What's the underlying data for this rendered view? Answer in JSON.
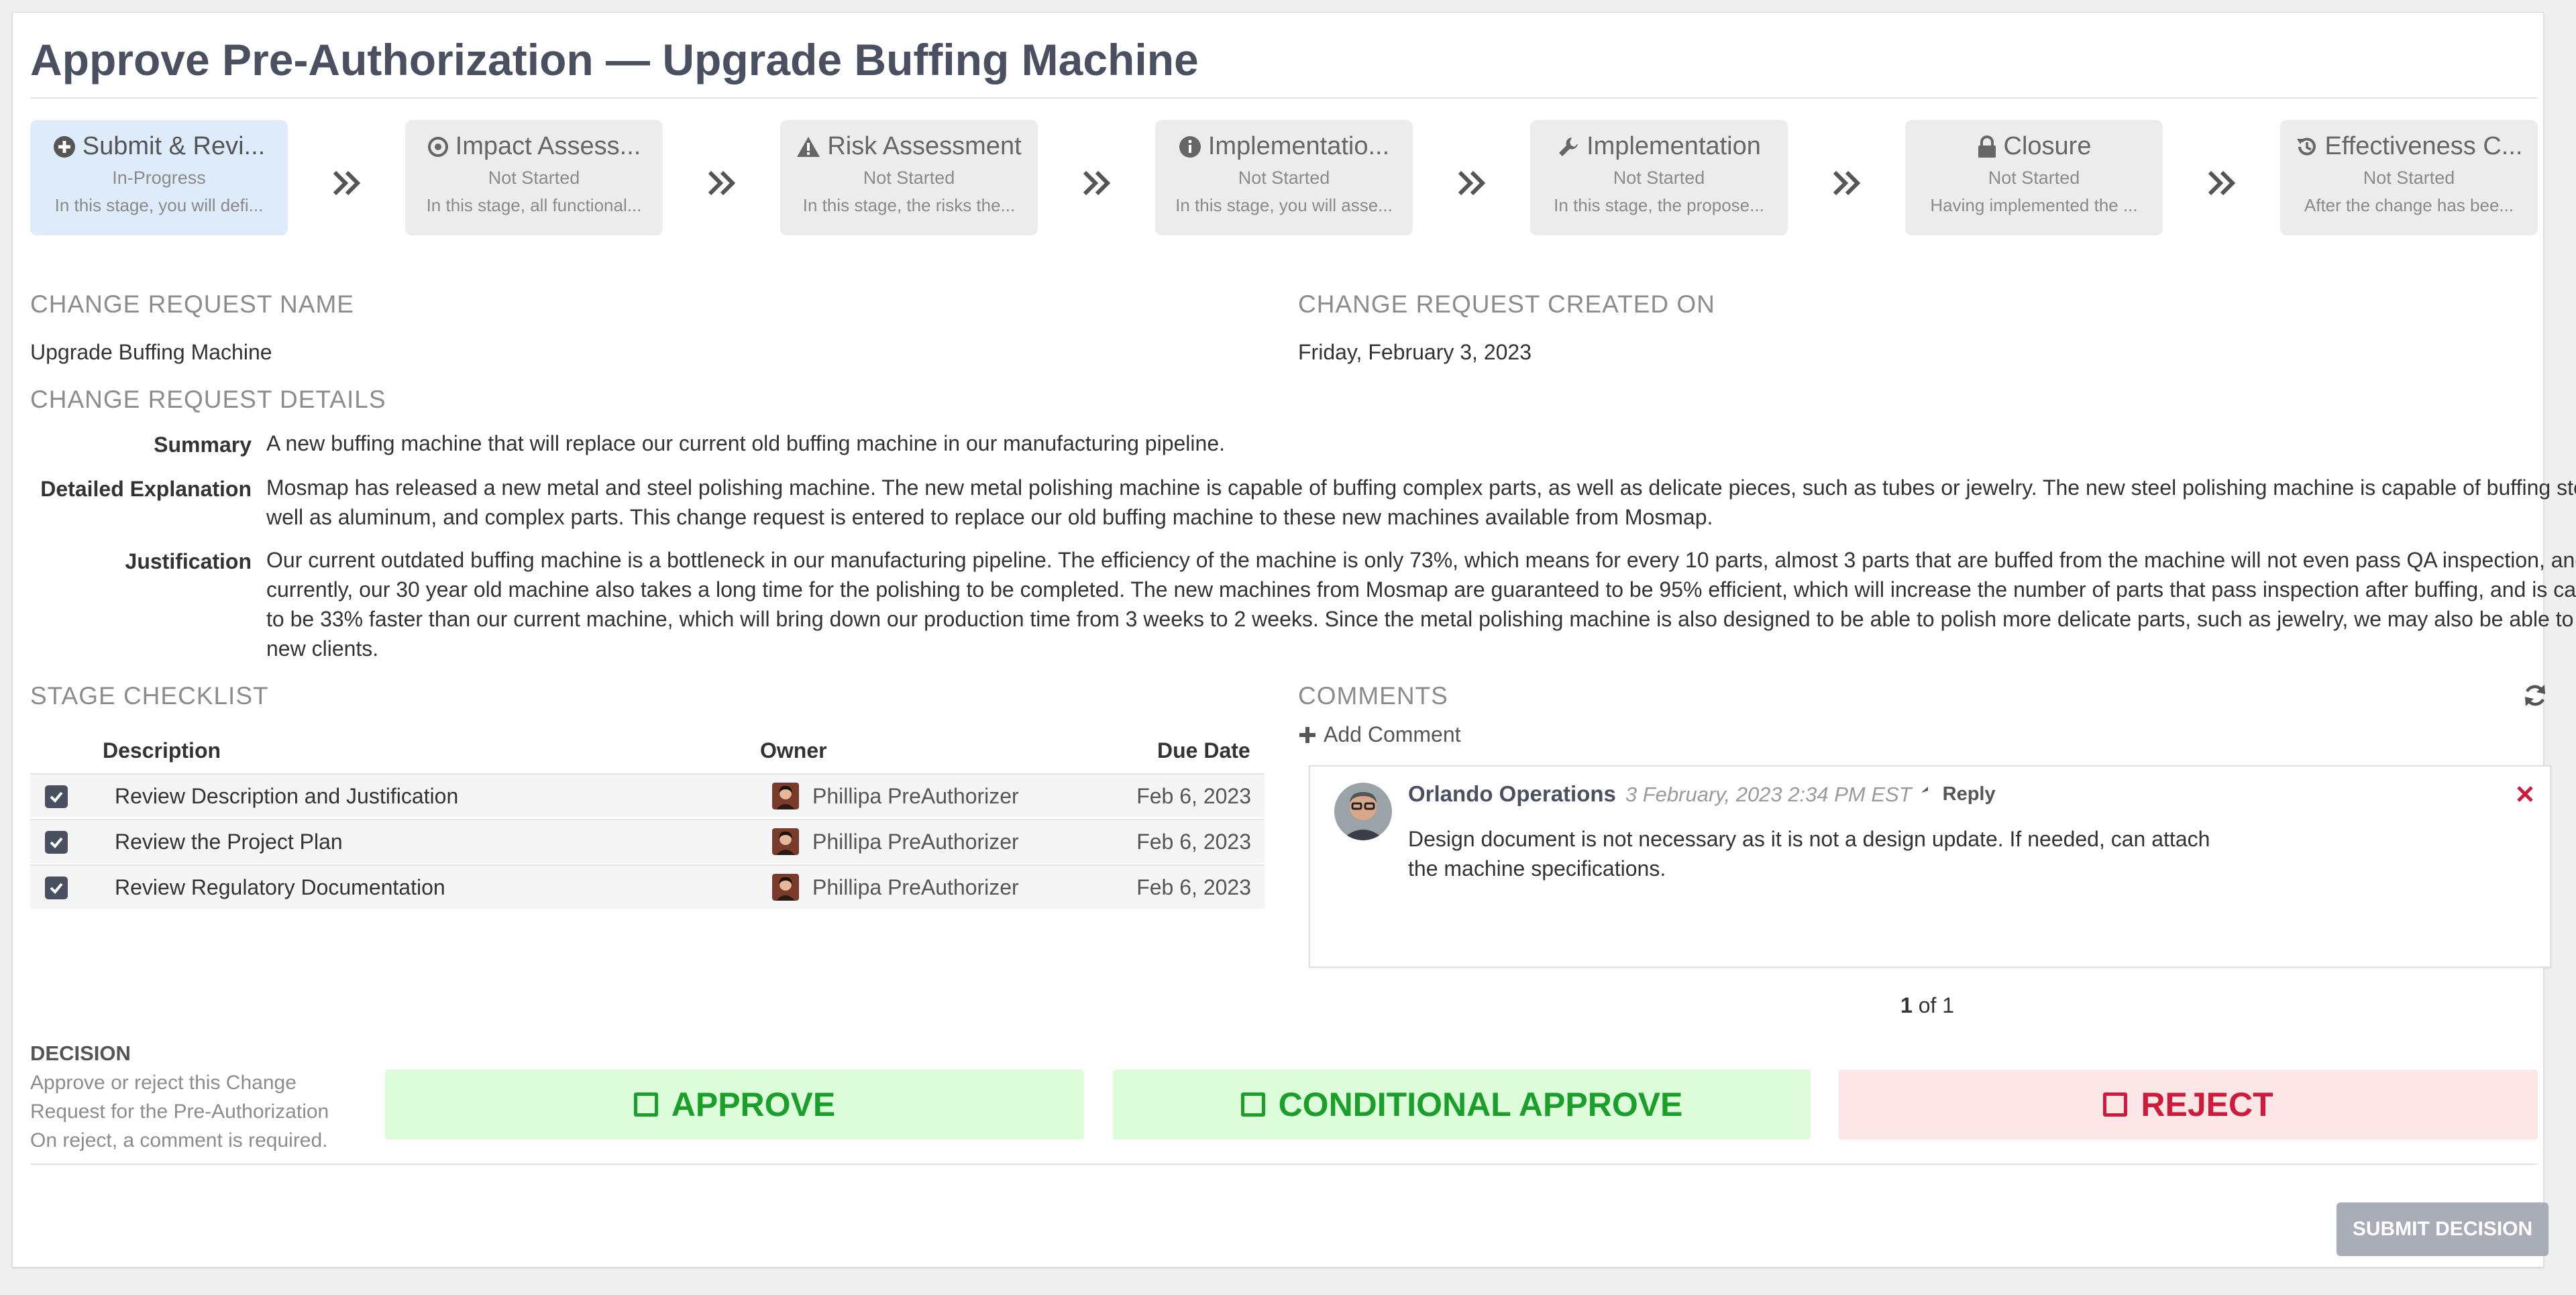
{
  "page": {
    "title": "Approve Pre-Authorization — Upgrade Buffing Machine"
  },
  "stages": [
    {
      "name": "Submit & Revi...",
      "status": "In-Progress",
      "desc": "In this stage, you will defi...",
      "icon": "plus-circle-icon"
    },
    {
      "name": "Impact Assess...",
      "status": "Not Started",
      "desc": "In this stage, all functional...",
      "icon": "target-icon"
    },
    {
      "name": "Risk Assessment",
      "status": "Not Started",
      "desc": "In this stage, the risks the...",
      "icon": "warning-icon"
    },
    {
      "name": "Implementatio...",
      "status": "Not Started",
      "desc": "In this stage, you will asse...",
      "icon": "info-icon"
    },
    {
      "name": "Implementation",
      "status": "Not Started",
      "desc": "In this stage, the propose...",
      "icon": "wrench-icon"
    },
    {
      "name": "Closure",
      "status": "Not Started",
      "desc": "Having implemented the ...",
      "icon": "lock-icon"
    },
    {
      "name": "Effectiveness C...",
      "status": "Not Started",
      "desc": "After the change has bee...",
      "icon": "history-icon"
    }
  ],
  "request": {
    "name_label": "CHANGE REQUEST NAME",
    "name": "Upgrade Buffing Machine",
    "created_label": "CHANGE REQUEST CREATED ON",
    "created": "Friday, February 3, 2023",
    "details_label": "CHANGE REQUEST DETAILS",
    "summary_label": "Summary",
    "summary": "A new buffing machine that will replace our current old buffing machine in our manufacturing pipeline.",
    "explanation_label": "Detailed Explanation",
    "explanation": "Mosmap has released a new metal and steel polishing machine. The new metal polishing machine is capable of buffing complex parts, as well as delicate pieces, such as tubes or jewelry. The new steel polishing machine is capable of buffing steel, as well as aluminum, and complex parts. This change request is entered to replace our old buffing machine to these new machines available from Mosmap.",
    "justification_label": "Justification",
    "justification": "Our current outdated buffing machine is a bottleneck in our manufacturing pipeline. The efficiency of the machine is only 73%, which means for every 10 parts, almost 3 parts that are buffed from the machine will not even pass QA inspection, and currently, our 30 year old machine also takes a long time for the polishing to be completed. The new machines from Mosmap are guaranteed to be 95% efficient, which will increase the number of parts that pass inspection after buffing, and is calculated to be 33% faster than our current machine, which will bring down our production time from 3 weeks to 2 weeks. Since the metal polishing machine is also designed to be able to polish more delicate parts, such as jewelry, we may also be able to bring in new clients."
  },
  "checklist": {
    "title": "STAGE CHECKLIST",
    "headers": {
      "description": "Description",
      "owner": "Owner",
      "due": "Due Date"
    },
    "rows": [
      {
        "description": "Review Description and Justification",
        "owner": "Phillipa PreAuthorizer",
        "due": "Feb 6, 2023"
      },
      {
        "description": "Review the Project Plan",
        "owner": "Phillipa PreAuthorizer",
        "due": "Feb 6, 2023"
      },
      {
        "description": "Review Regulatory Documentation",
        "owner": "Phillipa PreAuthorizer",
        "due": "Feb 6, 2023"
      }
    ]
  },
  "comments": {
    "title": "COMMENTS",
    "add_label": "Add Comment",
    "items": [
      {
        "author": "Orlando Operations",
        "time": "3 February, 2023 2:34 PM  EST",
        "reply_label": "Reply",
        "text": "Design document is not necessary as it is not a design update. If needed, can attach the machine specifications."
      }
    ],
    "pager_current": "1",
    "pager_rest": " of 1"
  },
  "decision": {
    "title": "DECISION",
    "help": [
      "Approve or reject this Change",
      "Request for the Pre-Authorization",
      "On reject, a comment is required."
    ],
    "approve_label": "APPROVE",
    "conditional_label": "CONDITIONAL APPROVE",
    "reject_label": "REJECT",
    "submit_label": "SUBMIT DECISION"
  },
  "colors": {
    "approve": "#1aa02a",
    "reject": "#d01a3c",
    "active_stage": "#ddebfb",
    "submit_disabled": "#a9adb8"
  }
}
